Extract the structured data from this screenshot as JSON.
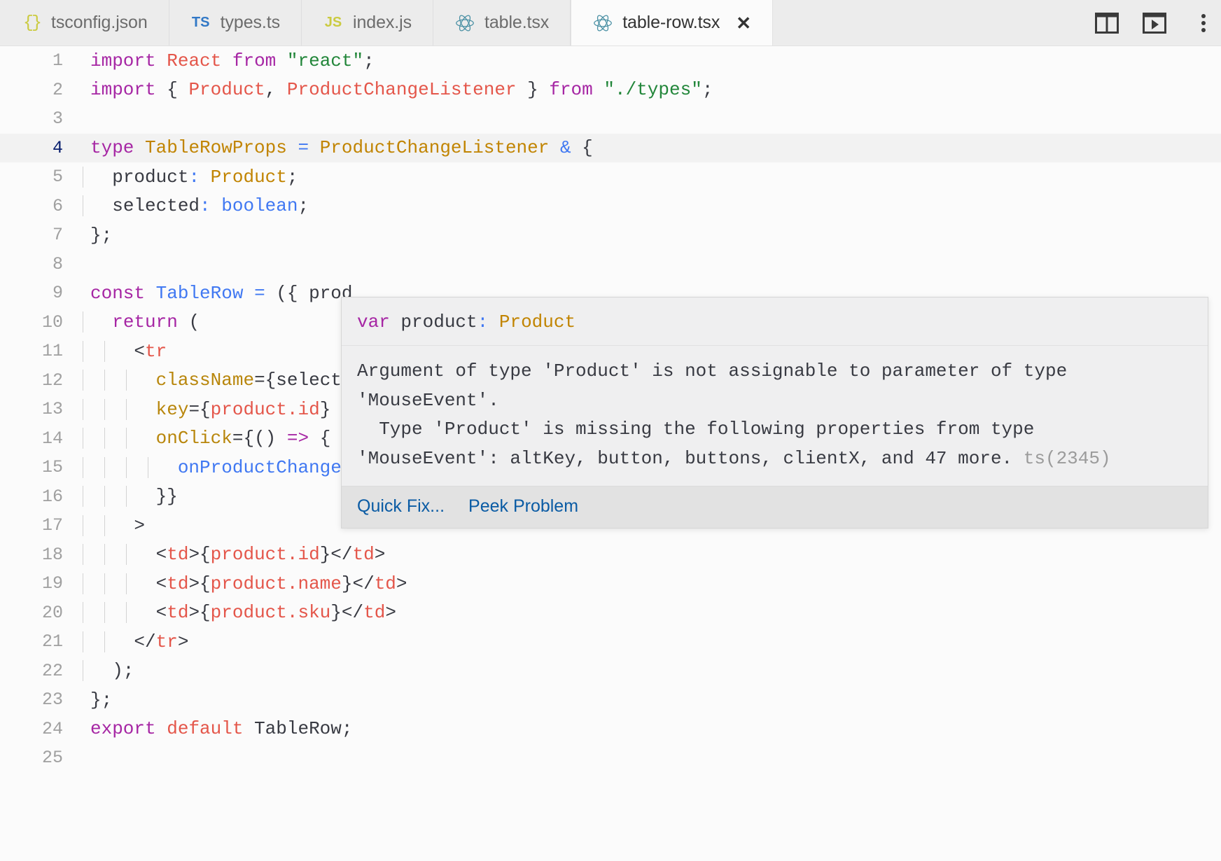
{
  "tabs": [
    {
      "label": "tsconfig.json",
      "icon": "json-braces-icon",
      "icon_text": "{}",
      "active": false,
      "closable": false
    },
    {
      "label": "types.ts",
      "icon": "typescript-icon",
      "icon_text": "TS",
      "active": false,
      "closable": false
    },
    {
      "label": "index.js",
      "icon": "javascript-icon",
      "icon_text": "JS",
      "active": false,
      "closable": false
    },
    {
      "label": "table.tsx",
      "icon": "react-icon",
      "icon_text": "",
      "active": false,
      "closable": false
    },
    {
      "label": "table-row.tsx",
      "icon": "react-icon",
      "icon_text": "",
      "active": true,
      "closable": true,
      "close_label": "✕"
    }
  ],
  "toolbar": {
    "split_editor_label": "split-editor",
    "run_label": "run-preview",
    "more_label": "more-actions"
  },
  "editor": {
    "active_line": 4,
    "lines": [
      {
        "n": "1",
        "text": "import React from \"react\";"
      },
      {
        "n": "2",
        "text": "import { Product, ProductChangeListener } from \"./types\";"
      },
      {
        "n": "3",
        "text": ""
      },
      {
        "n": "4",
        "text": "type TableRowProps = ProductChangeListener & {"
      },
      {
        "n": "5",
        "text": "  product: Product;"
      },
      {
        "n": "6",
        "text": "  selected: boolean;"
      },
      {
        "n": "7",
        "text": "};"
      },
      {
        "n": "8",
        "text": ""
      },
      {
        "n": "9",
        "text": "const TableRow = ({ product, selected, onProductChange }: TableRowProps) => {"
      },
      {
        "n": "10",
        "text": "  return ("
      },
      {
        "n": "11",
        "text": "    <tr"
      },
      {
        "n": "12",
        "text": "      className={selected ? \"selected\" : \"\"}"
      },
      {
        "n": "13",
        "text": "      key={product.id}"
      },
      {
        "n": "14",
        "text": "      onClick={() => {"
      },
      {
        "n": "15",
        "text": "        onProductChange(product);"
      },
      {
        "n": "16",
        "text": "      }}"
      },
      {
        "n": "17",
        "text": "    >"
      },
      {
        "n": "18",
        "text": "      <td>{product.id}</td>"
      },
      {
        "n": "19",
        "text": "      <td>{product.name}</td>"
      },
      {
        "n": "20",
        "text": "      <td>{product.sku}</td>"
      },
      {
        "n": "21",
        "text": "    </tr>"
      },
      {
        "n": "22",
        "text": "  );"
      },
      {
        "n": "23",
        "text": "};"
      },
      {
        "n": "24",
        "text": "export default TableRow;"
      },
      {
        "n": "25",
        "text": ""
      }
    ]
  },
  "hover": {
    "signature_keyword": "var",
    "signature_name": "product",
    "signature_colon": ":",
    "signature_type": "Product",
    "message_lines": [
      "Argument of type 'Product' is not assignable to parameter of type",
      "'MouseEvent'.",
      "  Type 'Product' is missing the following properties from type",
      "'MouseEvent': altKey, button, buttons, clientX, and 47 more."
    ],
    "error_code": "ts(2345)",
    "actions": [
      {
        "label": "Quick Fix..."
      },
      {
        "label": "Peek Problem"
      }
    ]
  }
}
